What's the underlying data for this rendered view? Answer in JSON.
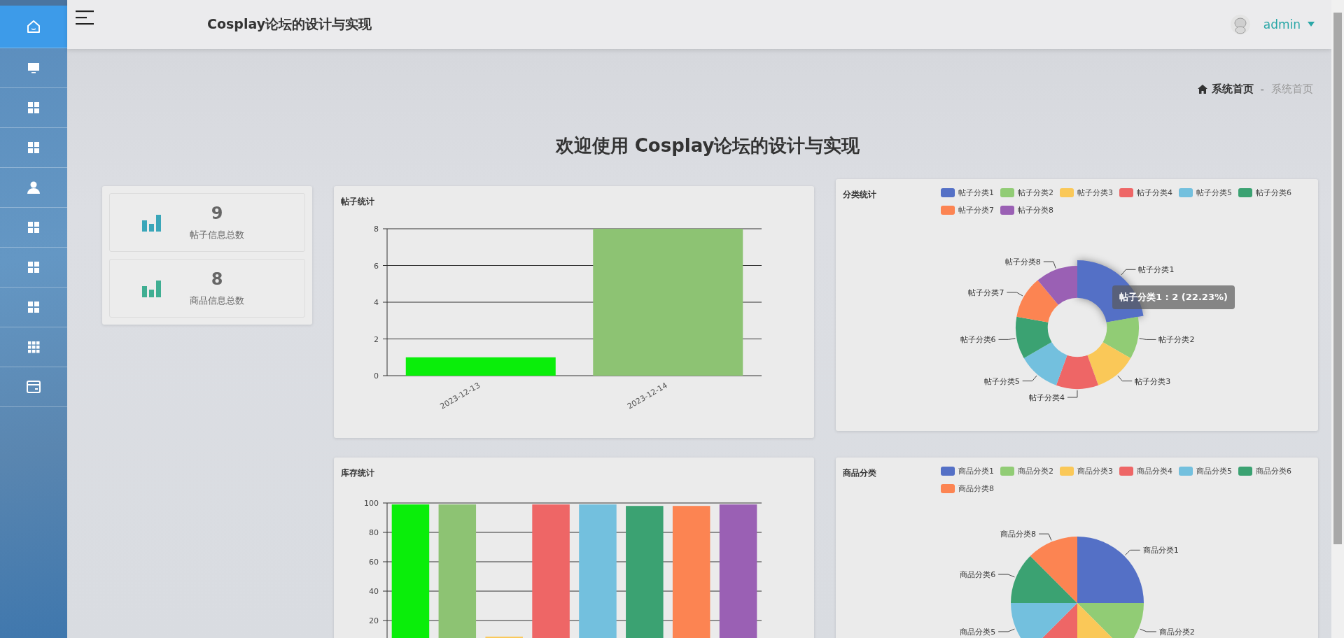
{
  "sidebar": {
    "items": [
      {
        "kind": "home",
        "selected": true
      },
      {
        "kind": "monitor",
        "selected": false
      },
      {
        "kind": "grid",
        "selected": false
      },
      {
        "kind": "grid",
        "selected": false
      },
      {
        "kind": "user",
        "selected": false
      },
      {
        "kind": "grid",
        "selected": false
      },
      {
        "kind": "grid",
        "selected": false
      },
      {
        "kind": "grid",
        "selected": false
      },
      {
        "kind": "apps",
        "selected": false
      },
      {
        "kind": "wallet",
        "selected": false
      }
    ]
  },
  "header": {
    "title": "Cosplay论坛的设计与实现",
    "user": "admin"
  },
  "breadcrumb": {
    "home": "系统首页",
    "separator": "-",
    "current": "系统首页"
  },
  "welcome": "欢迎使用 Cosplay论坛的设计与实现",
  "stats": [
    {
      "value": "9",
      "label": "帖子信息总数",
      "color": "#3aa6b9"
    },
    {
      "value": "8",
      "label": "商品信息总数",
      "color": "#3fae92"
    }
  ],
  "post_chart": {
    "bars": [
      {
        "color": "#0aee0a"
      },
      {
        "color": "#8dc373"
      }
    ],
    "chart_data": {
      "type": "bar",
      "title": "帖子统计",
      "categories": [
        "2023-12-13",
        "2023-12-14"
      ],
      "values": [
        1,
        8
      ],
      "ylim": [
        0,
        8
      ],
      "yticks": [
        0,
        2,
        4,
        6,
        8
      ],
      "grid": true
    }
  },
  "category_chart": {
    "tooltip": "帖子分类1 : 2 (22.23%)",
    "legend": [
      {
        "label": "帖子分类1",
        "color": "#5470c6",
        "highlighted": true
      },
      {
        "label": "帖子分类2",
        "color": "#91cc75",
        "highlighted": false
      },
      {
        "label": "帖子分类3",
        "color": "#fac858",
        "highlighted": false
      },
      {
        "label": "帖子分类4",
        "color": "#ee6666",
        "highlighted": false
      },
      {
        "label": "帖子分类5",
        "color": "#73c0de",
        "highlighted": false
      },
      {
        "label": "帖子分类6",
        "color": "#3ba272",
        "highlighted": false
      },
      {
        "label": "帖子分类7",
        "color": "#fc8452",
        "highlighted": false
      },
      {
        "label": "帖子分类8",
        "color": "#9a60b4",
        "highlighted": false
      }
    ],
    "chart_data": {
      "type": "donut",
      "title": "分类统计",
      "categories": [
        "帖子分类1",
        "帖子分类2",
        "帖子分类3",
        "帖子分类4",
        "帖子分类5",
        "帖子分类6",
        "帖子分类7",
        "帖子分类8"
      ],
      "values": [
        22.23,
        11.11,
        11.11,
        11.11,
        11.11,
        11.11,
        11.11,
        11.11
      ]
    }
  },
  "stock_chart": {
    "bars": [
      {
        "color": "#0aee0a"
      },
      {
        "color": "#8dc373"
      },
      {
        "color": "#fac858"
      },
      {
        "color": "#ee6666"
      },
      {
        "color": "#73c0de"
      },
      {
        "color": "#3ba272"
      },
      {
        "color": "#fc8452"
      },
      {
        "color": "#9a60b4"
      }
    ],
    "chart_data": {
      "type": "bar",
      "title": "库存统计",
      "values": [
        99,
        99,
        9,
        99,
        99,
        98,
        98,
        99
      ],
      "ylim": [
        0,
        100
      ],
      "yticks": [
        20,
        40,
        60,
        80,
        100
      ],
      "grid": true
    }
  },
  "goods_chart": {
    "legend": [
      {
        "label": "商品分类1",
        "color": "#5470c6",
        "highlighted": false,
        "slice_label": "商品分类1"
      },
      {
        "label": "商品分类2",
        "color": "#91cc75",
        "highlighted": false,
        "slice_label": "商品分类2"
      },
      {
        "label": "商品分类3",
        "color": "#fac858",
        "highlighted": false
      },
      {
        "label": "商品分类4",
        "color": "#ee6666",
        "highlighted": false
      },
      {
        "label": "商品分类5",
        "color": "#73c0de",
        "highlighted": false,
        "slice_label": "商品分类5"
      },
      {
        "label": "商品分类6",
        "color": "#3ba272",
        "highlighted": false,
        "slice_label": "商品分类6"
      },
      {
        "label": "商品分类8",
        "color": "#fc8452",
        "highlighted": false,
        "slice_label": "商品分类8"
      }
    ],
    "chart_data": {
      "type": "pie",
      "title": "商品分类",
      "values": [
        25,
        12.5,
        12.5,
        12.5,
        12.5,
        12.5,
        12.5
      ]
    }
  }
}
